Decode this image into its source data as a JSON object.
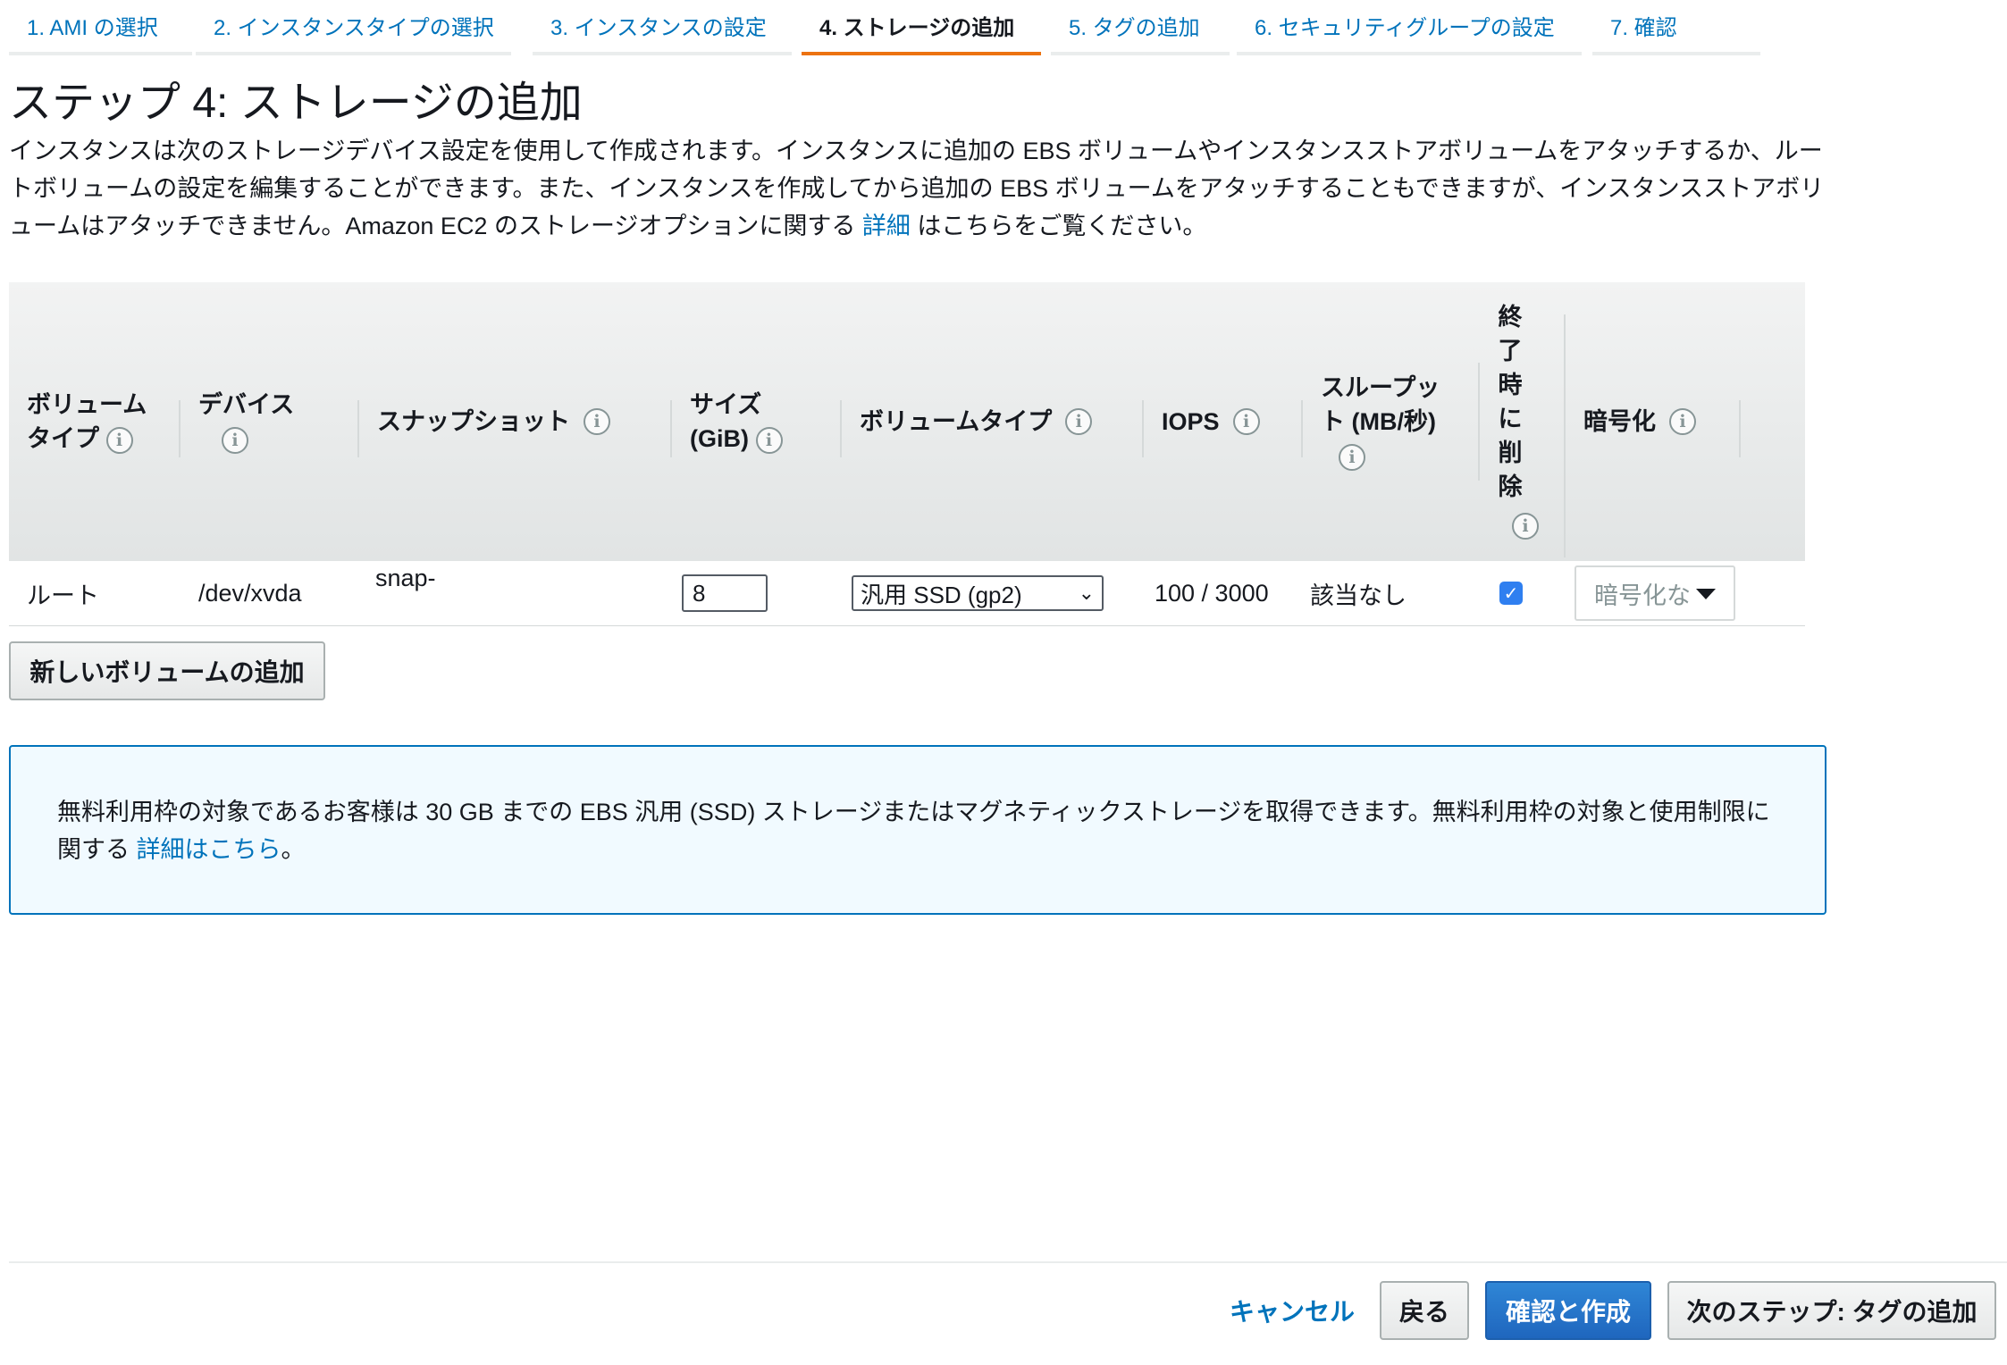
{
  "steps": [
    {
      "label": "1. AMI の選択"
    },
    {
      "label": "2. インスタンスタイプの選択"
    },
    {
      "label": "3. インスタンスの設定"
    },
    {
      "label": "4. ストレージの追加"
    },
    {
      "label": "5. タグの追加"
    },
    {
      "label": "6. セキュリティグループの設定"
    },
    {
      "label": "7. 確認"
    }
  ],
  "active_step": 3,
  "page": {
    "title": "ステップ 4: ストレージの追加",
    "description_before_link": "インスタンスは次のストレージデバイス設定を使用して作成されます。インスタンスに追加の EBS ボリュームやインスタンスストアボリュームをアタッチするか、ルートボリュームの設定を編集することができます。また、インスタンスを作成してから追加の EBS ボリュームをアタッチすることもできますが、インスタンスストアボリュームはアタッチできません。Amazon EC2 のストレージオプションに関する ",
    "description_link": "詳細",
    "description_after_link": " はこちらをご覧ください。"
  },
  "table": {
    "headers": {
      "volume_type_1": "ボリューム",
      "volume_type_2": "タイプ",
      "device": "デバイス",
      "snapshot": "スナップショット",
      "size_1": "サイズ",
      "size_2": "(GiB)",
      "ebs_type": "ボリュームタイプ",
      "iops": "IOPS",
      "throughput_1": "スループッ",
      "throughput_2": "ト (MB/秒)",
      "delete_chars": [
        "終",
        "了",
        "時",
        "に",
        "削",
        "除"
      ],
      "encryption": "暗号化"
    },
    "rows": [
      {
        "volume_type": "ルート",
        "device": "/dev/xvda",
        "snapshot": "snap-",
        "size": "8",
        "ebs_type": "汎用 SSD (gp2)",
        "iops": "100 / 3000",
        "throughput": "該当なし",
        "delete_on_termination": true,
        "encryption": "暗号化な"
      }
    ]
  },
  "buttons": {
    "add_volume": "新しいボリュームの追加",
    "cancel": "キャンセル",
    "back": "戻る",
    "review_launch": "確認と作成",
    "next": "次のステップ: タグの追加"
  },
  "info_box": {
    "text": "無料利用枠の対象であるお客様は 30 GB までの EBS 汎用 (SSD) ストレージまたはマグネティックストレージを取得できます。無料利用枠の対象と使用制限に関する ",
    "link": "詳細はこちら",
    "suffix": "。"
  },
  "icons": {
    "info": "i",
    "check": "✓"
  },
  "colors": {
    "link": "#0073bb",
    "active_tab": "#ec7211",
    "primary_button": "#1f66be",
    "checkbox": "#2f7ff0"
  }
}
